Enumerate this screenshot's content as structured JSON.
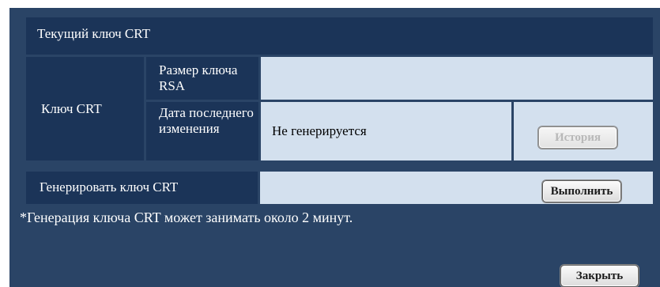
{
  "section": {
    "title": "Текущий ключ CRT"
  },
  "key_table": {
    "row_label": "Ключ CRT",
    "rsa_size_label": "Размер ключа RSA",
    "rsa_size_value": "",
    "last_modified_label": "Дата последнего изменения",
    "last_modified_value": "Не генерируется",
    "history_button": "История"
  },
  "generate": {
    "label": "Генерировать ключ CRT",
    "execute_button": "Выполнить"
  },
  "note": "*Генерация ключа CRT может занимать около 2 минут.",
  "footer": {
    "close_button": "Закрыть"
  }
}
